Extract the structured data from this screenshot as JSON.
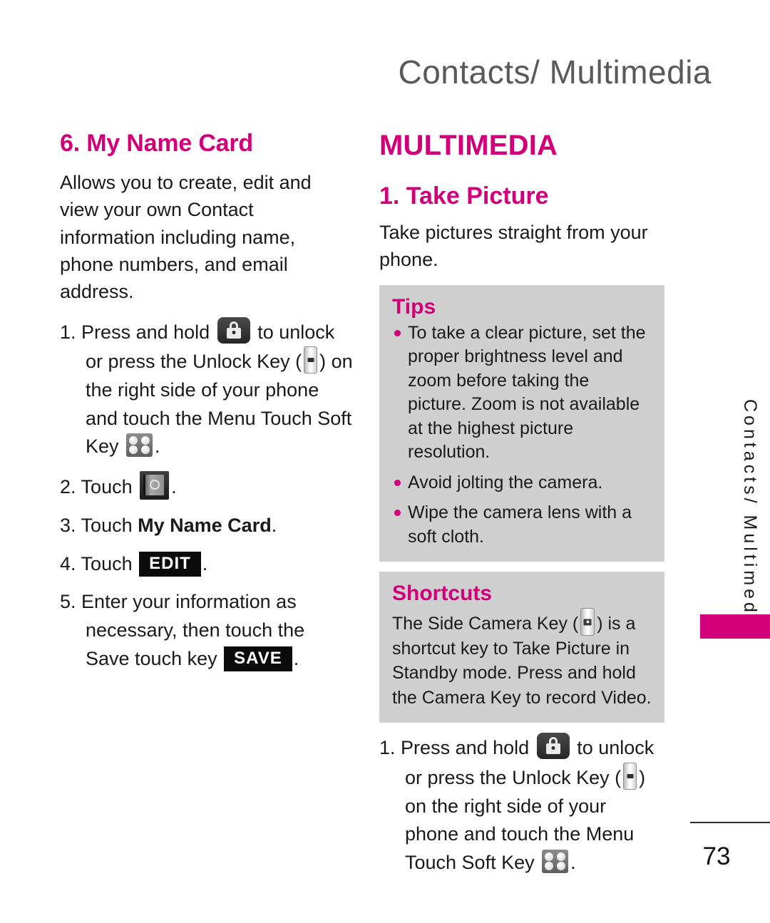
{
  "header": {
    "title": "Contacts/ Multimedia"
  },
  "left_column": {
    "heading": "6. My Name Card",
    "intro": "Allows you to create, edit and view your own Contact information including name, phone numbers, and email address.",
    "steps": [
      {
        "num": "1.",
        "part1": "Press and hold",
        "icon1": "lock-icon",
        "part2": "to unlock or press the Unlock Key (",
        "icon2": "unlock-key-icon",
        "part3": ") on the right side of your phone and touch the Menu Touch Soft Key",
        "icon3": "menu-touch-soft-key-icon",
        "part4": "."
      },
      {
        "num": "2.",
        "part1": "Touch",
        "icon1": "contacts-icon",
        "part2": "."
      },
      {
        "num": "3.",
        "part1": "Touch",
        "bold": "My Name Card",
        "part2": "."
      },
      {
        "num": "4.",
        "part1": "Touch",
        "softkey": "EDIT",
        "part2": "."
      },
      {
        "num": "5.",
        "part1": "Enter your information as necessary, then touch the Save touch key",
        "softkey": "SAVE",
        "part2": "."
      }
    ]
  },
  "right_column": {
    "section_heading": "MULTIMEDIA",
    "sub_heading": "1. Take Picture",
    "intro": "Take pictures straight from your phone.",
    "tips": {
      "title": "Tips",
      "items": [
        "To take a clear picture, set the proper brightness level and zoom before taking the picture. Zoom is not available at the highest picture resolution.",
        "Avoid jolting the camera.",
        "Wipe the camera lens with a soft cloth."
      ]
    },
    "shortcuts": {
      "title": "Shortcuts",
      "part1": "The Side Camera Key (",
      "icon": "side-camera-key-icon",
      "part2": ") is a shortcut key to Take Picture in Standby mode. Press and hold the Camera Key to record Video."
    },
    "step": {
      "num": "1.",
      "part1": "Press and hold",
      "icon1": "lock-icon",
      "part2": "to unlock or press the Unlock Key (",
      "icon2": "unlock-key-icon",
      "part3": ") on the right side of your phone and touch the Menu Touch Soft Key",
      "icon3": "menu-touch-soft-key-icon",
      "part4": "."
    }
  },
  "side_tab": {
    "label": "Contacts/ Multimedia",
    "color": "#D1007A"
  },
  "footer": {
    "page_number": "73"
  },
  "colors": {
    "accent": "#D1007A",
    "box_background": "#cfcfcf",
    "header_gray": "#595959"
  }
}
